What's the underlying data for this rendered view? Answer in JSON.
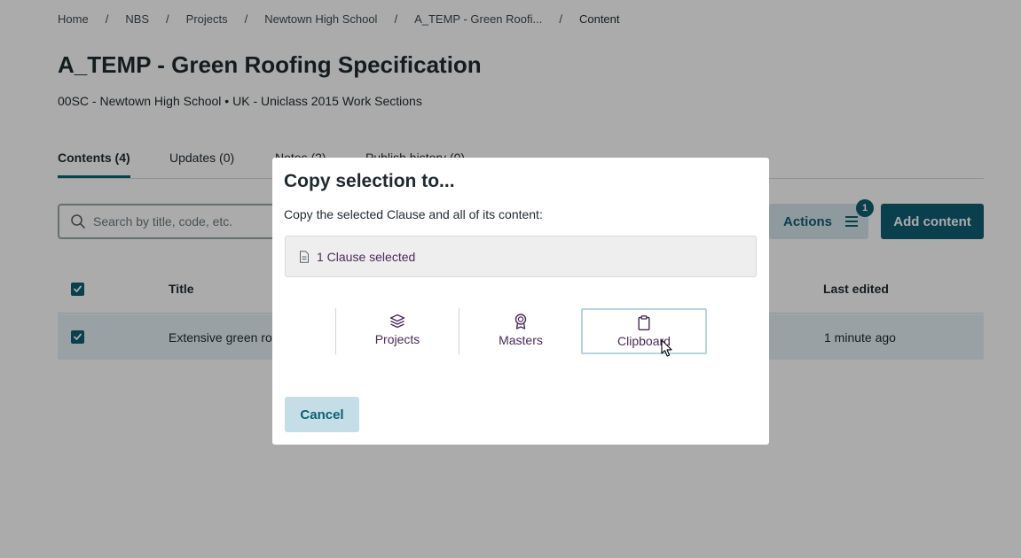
{
  "breadcrumb": {
    "items": [
      {
        "label": "Home"
      },
      {
        "label": "NBS"
      },
      {
        "label": "Projects"
      },
      {
        "label": "Newtown High School"
      },
      {
        "label": "A_TEMP - Green Roofi..."
      },
      {
        "label": "Content"
      }
    ],
    "separator": "/"
  },
  "page": {
    "title": "A_TEMP - Green Roofing Specification",
    "subtitle": "00SC - Newtown High School • UK - Uniclass 2015 Work Sections"
  },
  "tabs": [
    {
      "label": "Contents (4)",
      "active": true
    },
    {
      "label": "Updates (0)",
      "active": false
    },
    {
      "label": "Notes (2)",
      "active": false
    },
    {
      "label": "Publish history (0)",
      "active": false
    }
  ],
  "toolbar": {
    "search_placeholder": "Search by title, code, etc.",
    "actions_label": "Actions",
    "actions_badge": "1",
    "add_label": "Add content"
  },
  "table": {
    "headers": {
      "title": "Title",
      "last_edited": "Last edited"
    },
    "rows": [
      {
        "title": "Extensive green ro",
        "last_edited": "1 minute ago",
        "selected": true
      }
    ]
  },
  "modal": {
    "title": "Copy selection to...",
    "description": "Copy the selected Clause and all of its content:",
    "selection_text": "1 Clause selected",
    "destinations": [
      {
        "label": "Projects",
        "icon": "layers-icon"
      },
      {
        "label": "Masters",
        "icon": "award-icon"
      },
      {
        "label": "Clipboard",
        "icon": "clipboard-icon",
        "selected": true
      }
    ],
    "cancel_label": "Cancel"
  },
  "colors": {
    "brand": "#0f5e73",
    "accent_purple": "#4a2a5a",
    "overlay": "rgba(0,0,0,0.33)"
  }
}
